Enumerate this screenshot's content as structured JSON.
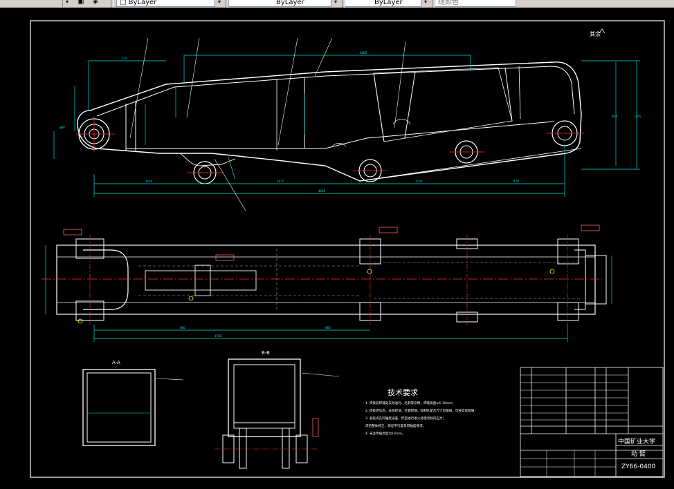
{
  "toolbar": {
    "layer_control": "ByLayer",
    "linetype_control": "ByLayer",
    "lineweight_control": "ByLayer",
    "plotstyle_control": "随颜色"
  },
  "drawing": {
    "label_top_right": "其余",
    "title_tech": "技术要求",
    "tech_notes": [
      "1. 焊接前焊缝处去除油污、毛刺等杂物，焊缝高度≥6-10mm；",
      "2. 焊接完毕后，去除焊渣，打磨焊缝，铰制孔配合尺寸见图纸，可按实际配做；",
      "3. 各铰点孔同轴度误差，焊后进行退火处理消除内应力；",
      "   焊后整体校正，保证平行度及同轴度要求；",
      "4. 未注焊缝高度为10mm。"
    ],
    "section_aa": "A-A",
    "section_bb": "B-B",
    "university": "中国矿业大学",
    "part_name": "动  臂",
    "drawing_no": "ZY66-0400"
  }
}
